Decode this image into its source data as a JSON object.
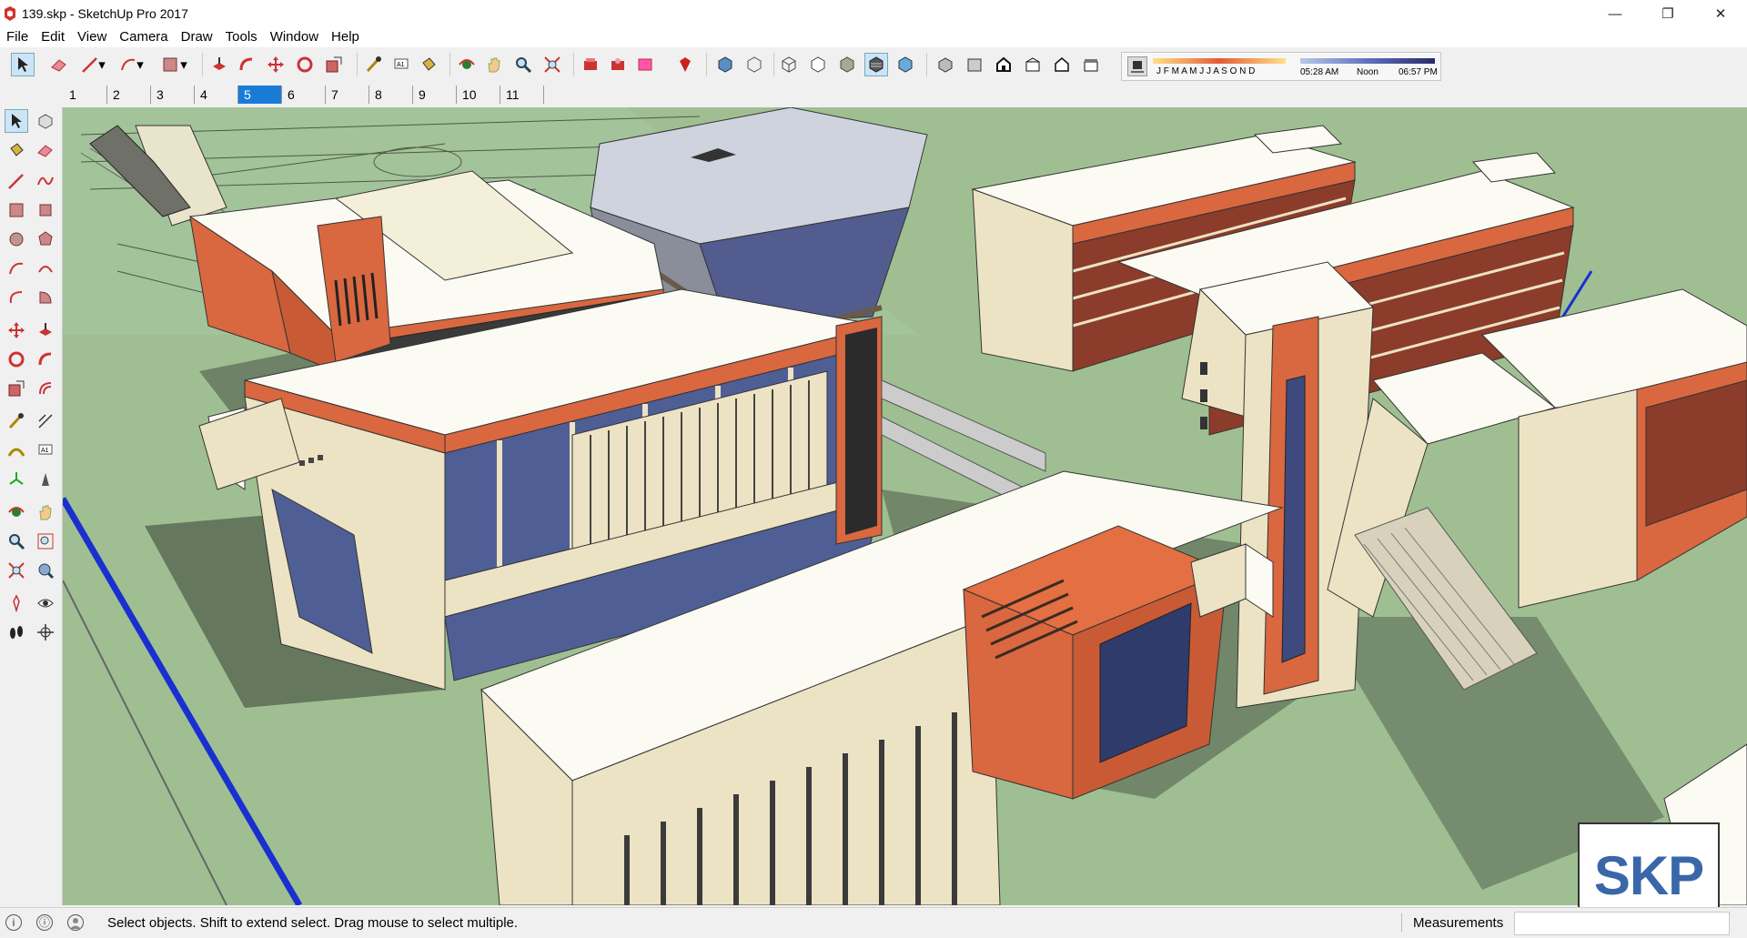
{
  "window": {
    "title": "139.skp - SketchUp Pro 2017",
    "controls": [
      "—",
      "❐",
      "✕"
    ]
  },
  "menu": [
    "File",
    "Edit",
    "View",
    "Camera",
    "Draw",
    "Tools",
    "Window",
    "Help"
  ],
  "shadow_settings": {
    "months": "J F M A M J J A S O N D",
    "time_start": "05:28 AM",
    "time_mid": "Noon",
    "time_end": "06:57 PM"
  },
  "scenes": [
    "1",
    "2",
    "3",
    "4",
    "5",
    "6",
    "7",
    "8",
    "9",
    "10",
    "11"
  ],
  "active_scene": "5",
  "status": {
    "message": "Select objects. Shift to extend select. Drag mouse to select multiple.",
    "measurements_label": "Measurements",
    "measurements_value": ""
  },
  "watermark": "SKP",
  "colors": {
    "ground": "#9fbf92",
    "roof": "#fbfaf3",
    "accent_orange": "#d9673f",
    "wall_cream": "#ece3c4",
    "glass": "#4f5f95",
    "scene_active": "#1a7bd6"
  }
}
